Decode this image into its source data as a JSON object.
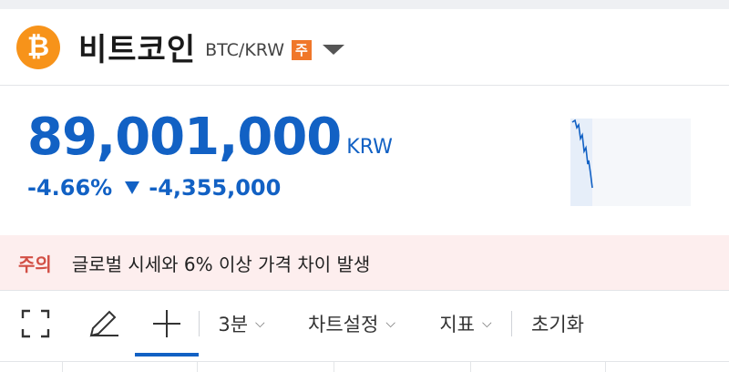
{
  "header": {
    "coin_symbol": "₿",
    "coin_name": "비트코인",
    "pair": "BTC/KRW",
    "caution_badge": "주",
    "logo_color": "#f7931a"
  },
  "price": {
    "current": "89,001,000",
    "currency": "KRW",
    "change_percent": "-4.66%",
    "change_amount": "-4,355,000",
    "direction": "down",
    "color": "#1261c4"
  },
  "caution": {
    "label": "주의",
    "message": "글로벌 시세와 6% 이상 가격 차이 발생"
  },
  "toolbar": {
    "fullscreen_icon": "fullscreen-icon",
    "draw_icon": "pencil-icon",
    "crosshair_icon": "crosshair-icon",
    "interval": "3분",
    "chart_settings": "차트설정",
    "indicators": "지표",
    "reset": "초기화"
  }
}
